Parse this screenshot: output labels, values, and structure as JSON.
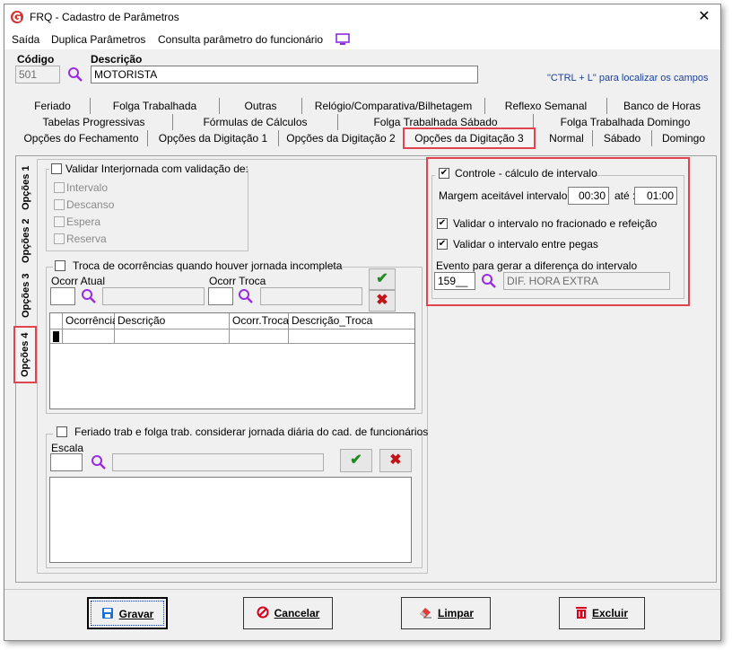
{
  "window": {
    "title": "FRQ - Cadastro de Parâmetros",
    "close_glyph": "✕",
    "brand_color": "#d6322f",
    "accent_color": "#e0444e"
  },
  "menu": {
    "items": [
      "Saída",
      "Duplica Parâmetros",
      "Consulta parâmetro do funcionário"
    ],
    "icon": "monitor-icon"
  },
  "header": {
    "codigo_label": "Código",
    "codigo_value": "501",
    "descricao_label": "Descrição",
    "descricao_value": "MOTORISTA",
    "hint": "\"CTRL + L\" para localizar os campos"
  },
  "tabs": {
    "row1": [
      "Feriado",
      "Folga Trabalhada",
      "Outras",
      "Relógio/Comparativa/Bilhetagem",
      "Reflexo Semanal",
      "Banco de Horas"
    ],
    "row2": [
      "Tabelas Progressivas",
      "Fórmulas de Cálculos",
      "Folga Trabalhada Sábado",
      "Folga Trabalhada Domingo"
    ],
    "row3": [
      "Opções do Fechamento",
      "Opções da Digitação 1",
      "Opções da Digitação 2",
      "Opções da Digitação 3",
      "Normal",
      "Sábado",
      "Domingo"
    ],
    "active": "Opções da Digitação 3"
  },
  "vtabs": {
    "items": [
      "Opções 1",
      "Opções 2",
      "Opções 3",
      "Opções 4"
    ],
    "active": "Opções 4"
  },
  "interjornada": {
    "main_label": "Validar Interjornada com validação de:",
    "main_checked": false,
    "options": [
      {
        "label": "Intervalo",
        "checked": false
      },
      {
        "label": "Descanso",
        "checked": false
      },
      {
        "label": "Espera",
        "checked": false
      },
      {
        "label": "Reserva",
        "checked": false
      }
    ]
  },
  "troca": {
    "label": "Troca de ocorrências quando houver jornada incompleta",
    "checked": false,
    "ocorr_atual_label": "Ocorr Atual",
    "ocorr_troca_label": "Ocorr Troca",
    "grid_headers": [
      "Ocorrência",
      "Descrição",
      "Ocorr.Troca",
      "Descrição_Troca"
    ],
    "confirm_glyph": "✔",
    "delete_glyph": "✖"
  },
  "feriado": {
    "label": "Feriado trab e folga trab. considerar jornada diária do cad. de funcionários",
    "checked": false,
    "escala_label": "Escala",
    "confirm_glyph": "✔",
    "delete_glyph": "✖"
  },
  "controle": {
    "label": "Controle - cálculo de intervalo",
    "checked": true,
    "margem_label": "Margem aceitável intervalo :",
    "margem_from": "00:30",
    "ate_label": "até :",
    "margem_to": "01:00",
    "fracionado_label": "Validar o intervalo no fracionado e refeição",
    "fracionado_checked": true,
    "pegas_label": "Validar o intervalo entre pegas",
    "pegas_checked": true,
    "evento_label": "Evento para gerar a diferença do intervalo",
    "evento_code": "159__",
    "evento_desc": "DIF. HORA EXTRA"
  },
  "buttons": {
    "gravar": "Gravar",
    "cancelar": "Cancelar",
    "limpar": "Limpar",
    "excluir": "Excluir"
  },
  "check_glyph": "✔"
}
